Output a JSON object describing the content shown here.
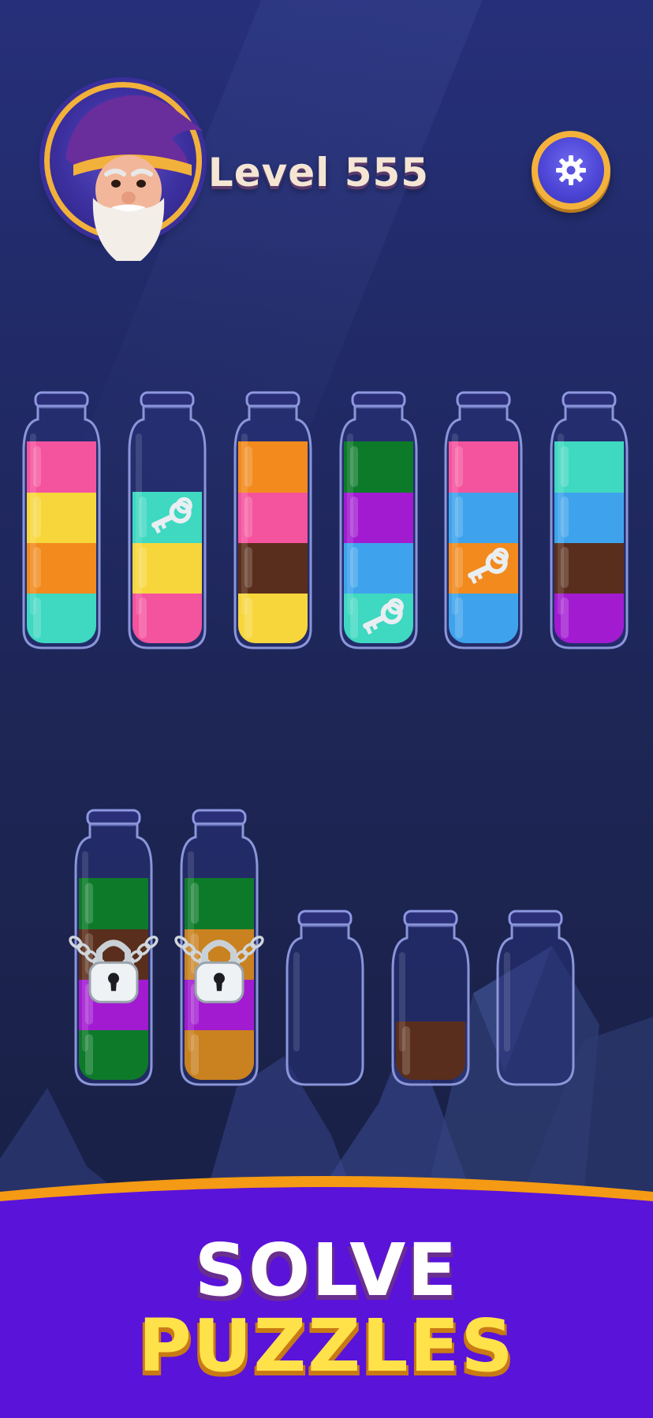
{
  "header": {
    "level_label": "Level 555",
    "avatar_icon": "wizard-avatar-icon",
    "settings_icon": "gear-icon"
  },
  "palette": {
    "pink": "#f4539e",
    "yellow": "#f7d63c",
    "orange": "#f28a1d",
    "cyan": "#3fd8c1",
    "brown": "#5a2e1c",
    "green": "#0d7a2a",
    "purple": "#a21bd1",
    "blue": "#3ea3ec",
    "mustard": "#c9821f"
  },
  "tubes_top_row": [
    {
      "id": 1,
      "layers_bottom_to_top": [
        "cyan",
        "orange",
        "yellow",
        "pink"
      ],
      "keys_on_layer": [],
      "locked": false
    },
    {
      "id": 2,
      "layers_bottom_to_top": [
        "pink",
        "yellow",
        "cyan"
      ],
      "keys_on_layer": [
        2
      ],
      "locked": false
    },
    {
      "id": 3,
      "layers_bottom_to_top": [
        "yellow",
        "brown",
        "pink",
        "orange"
      ],
      "keys_on_layer": [],
      "locked": false
    },
    {
      "id": 4,
      "layers_bottom_to_top": [
        "cyan",
        "blue",
        "purple",
        "green"
      ],
      "keys_on_layer": [
        0
      ],
      "locked": false
    },
    {
      "id": 5,
      "layers_bottom_to_top": [
        "blue",
        "orange",
        "blue",
        "pink"
      ],
      "keys_on_layer": [
        1
      ],
      "locked": false
    },
    {
      "id": 6,
      "layers_bottom_to_top": [
        "purple",
        "brown",
        "blue",
        "cyan"
      ],
      "keys_on_layer": [],
      "locked": false
    }
  ],
  "tubes_bottom_row": [
    {
      "id": 7,
      "layers_bottom_to_top": [
        "green",
        "purple",
        "brown",
        "green"
      ],
      "locked": true
    },
    {
      "id": 8,
      "layers_bottom_to_top": [
        "mustard",
        "purple",
        "mustard",
        "green"
      ],
      "locked": true
    },
    {
      "id": 9,
      "layers_bottom_to_top": [],
      "locked": false
    },
    {
      "id": 10,
      "layers_bottom_to_top": [
        "brown"
      ],
      "locked": false
    },
    {
      "id": 11,
      "layers_bottom_to_top": [],
      "locked": false
    }
  ],
  "banner": {
    "line1": "SOLVE",
    "line2": "PUZZLES",
    "bg_color": "#5a13d9",
    "rim_color": "#f59a14"
  }
}
